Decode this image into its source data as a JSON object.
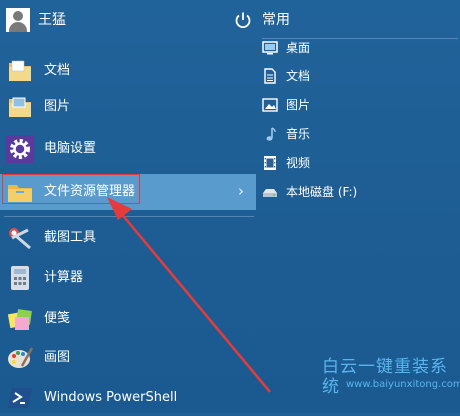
{
  "user": {
    "name": "王猛"
  },
  "left_menu": [
    {
      "label": "文档",
      "icon": "folder-docs-icon"
    },
    {
      "label": "图片",
      "icon": "folder-pictures-icon"
    },
    {
      "label": "电脑设置",
      "icon": "gear-icon"
    },
    {
      "label": "文件资源管理器",
      "icon": "file-explorer-icon",
      "has_submenu": true,
      "highlighted": true
    },
    {
      "label": "截图工具",
      "icon": "scissors-icon"
    },
    {
      "label": "计算器",
      "icon": "calculator-icon"
    },
    {
      "label": "便笺",
      "icon": "sticky-notes-icon"
    },
    {
      "label": "画图",
      "icon": "paint-palette-icon"
    },
    {
      "label": "Windows PowerShell",
      "icon": "powershell-icon"
    }
  ],
  "right_panel": {
    "title": "常用",
    "places": [
      {
        "label": "桌面",
        "icon": "desktop-icon"
      },
      {
        "label": "文档",
        "icon": "document-icon"
      },
      {
        "label": "图片",
        "icon": "picture-icon"
      },
      {
        "label": "音乐",
        "icon": "music-icon"
      },
      {
        "label": "视频",
        "icon": "video-icon"
      },
      {
        "label": "本地磁盘 (F:)",
        "icon": "disk-icon"
      }
    ]
  },
  "watermark": {
    "title": "白云一键重装系统",
    "url": "www.baiyunxitong.com"
  },
  "colors": {
    "background": "#1f5f95",
    "highlight": "#5a9bce",
    "annotation": "#e53b3b",
    "watermark": "#5ab4ee"
  }
}
